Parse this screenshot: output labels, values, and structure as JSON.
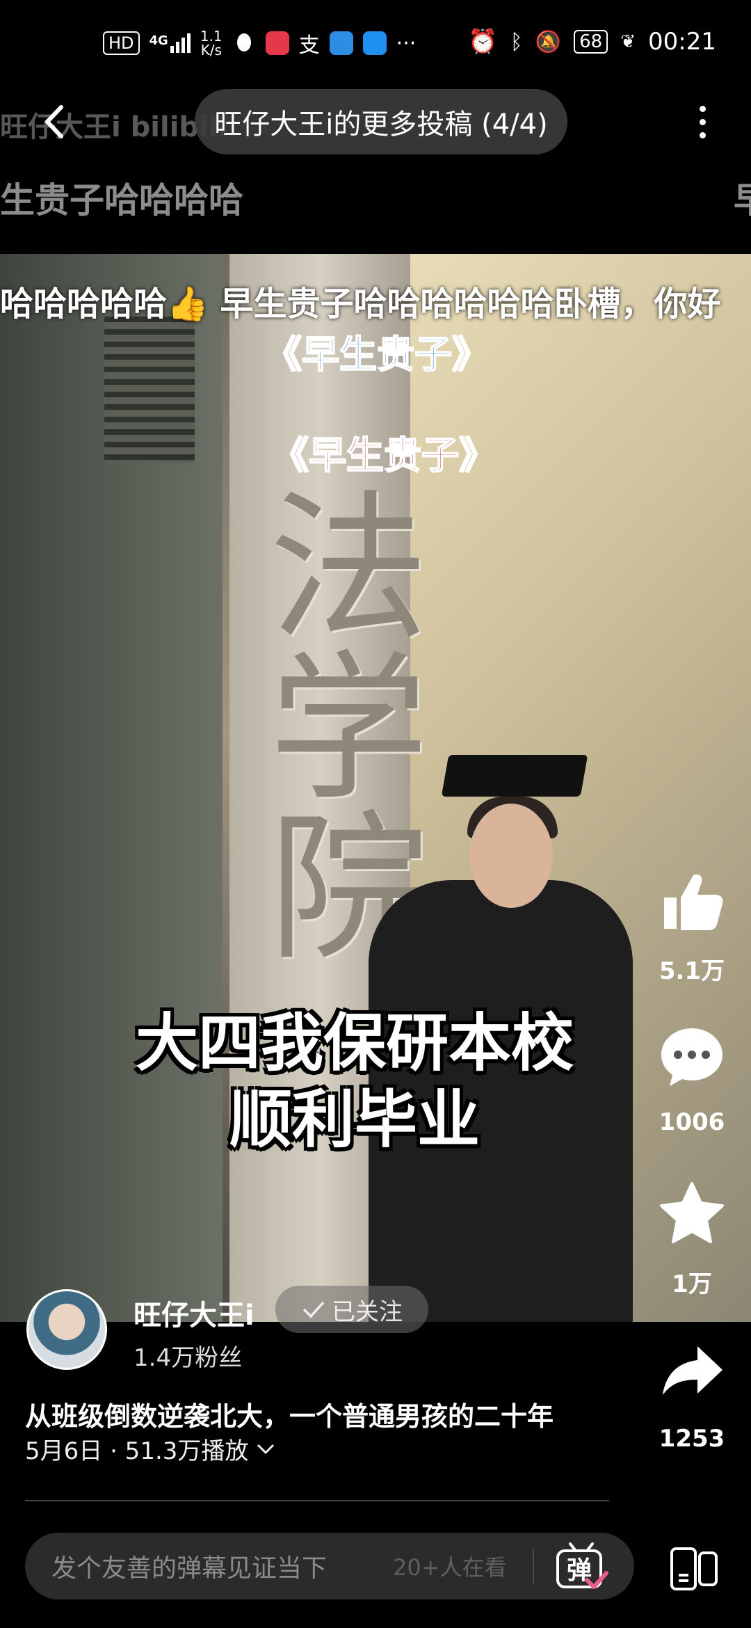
{
  "status_bar": {
    "hd": "HD",
    "network": "4G",
    "speed_value": "1.1",
    "speed_unit": "K/s",
    "battery": "68",
    "time": "00:21"
  },
  "top_bar": {
    "title": "旺仔大王i的更多投稿 (4/4)",
    "watermark": "旺仔大王i bilibili"
  },
  "danmaku": {
    "line1": "生贵子哈哈哈哈",
    "line1_right": "早",
    "line2": "哈哈哈哈哈👍 早生贵子哈哈哈哈哈哈卧槽，你好"
  },
  "video": {
    "overlay_sub_1": "《早生贵子》",
    "overlay_sub_2": "《早生贵子》",
    "sign": "法学院",
    "caption_line1": "大四我保研本校",
    "caption_line2": "顺利毕业"
  },
  "actions": {
    "like_count": "5.1万",
    "comment_count": "1006",
    "favorite_count": "1万",
    "share_count": "1253"
  },
  "author": {
    "name": "旺仔大王i",
    "follow_label": "已关注",
    "fans": "1.4万粉丝"
  },
  "video_info": {
    "title": "从班级倒数逆袭北大，一个普通男孩的二十年",
    "meta": "5月6日 · 51.3万播放"
  },
  "bottom_bar": {
    "placeholder": "发个友善的弹幕见证当下",
    "watching": "20+人在看",
    "danmu_label": "弹"
  },
  "colors": {
    "background": "#000000",
    "input_bg": "#2b2b2b",
    "subtitle_blue": "#2b6fbf",
    "subtitle_red": "#c9262b",
    "danmu_check": "#e95f8a"
  }
}
